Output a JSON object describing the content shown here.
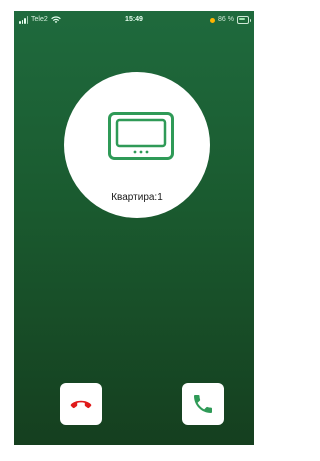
{
  "status_bar": {
    "carrier": "Tele2",
    "time": "15:49",
    "battery_percent": "86 %"
  },
  "call": {
    "apartment_label": "Квартира:1"
  },
  "colors": {
    "background_top": "#1f6a3d",
    "background_bottom": "#153f1f",
    "accent_green": "#2f9a57",
    "decline_red": "#e01a1a"
  },
  "icons": {
    "panel": "intercom-monitor-icon",
    "decline": "phone-hangup-icon",
    "accept": "phone-icon"
  }
}
